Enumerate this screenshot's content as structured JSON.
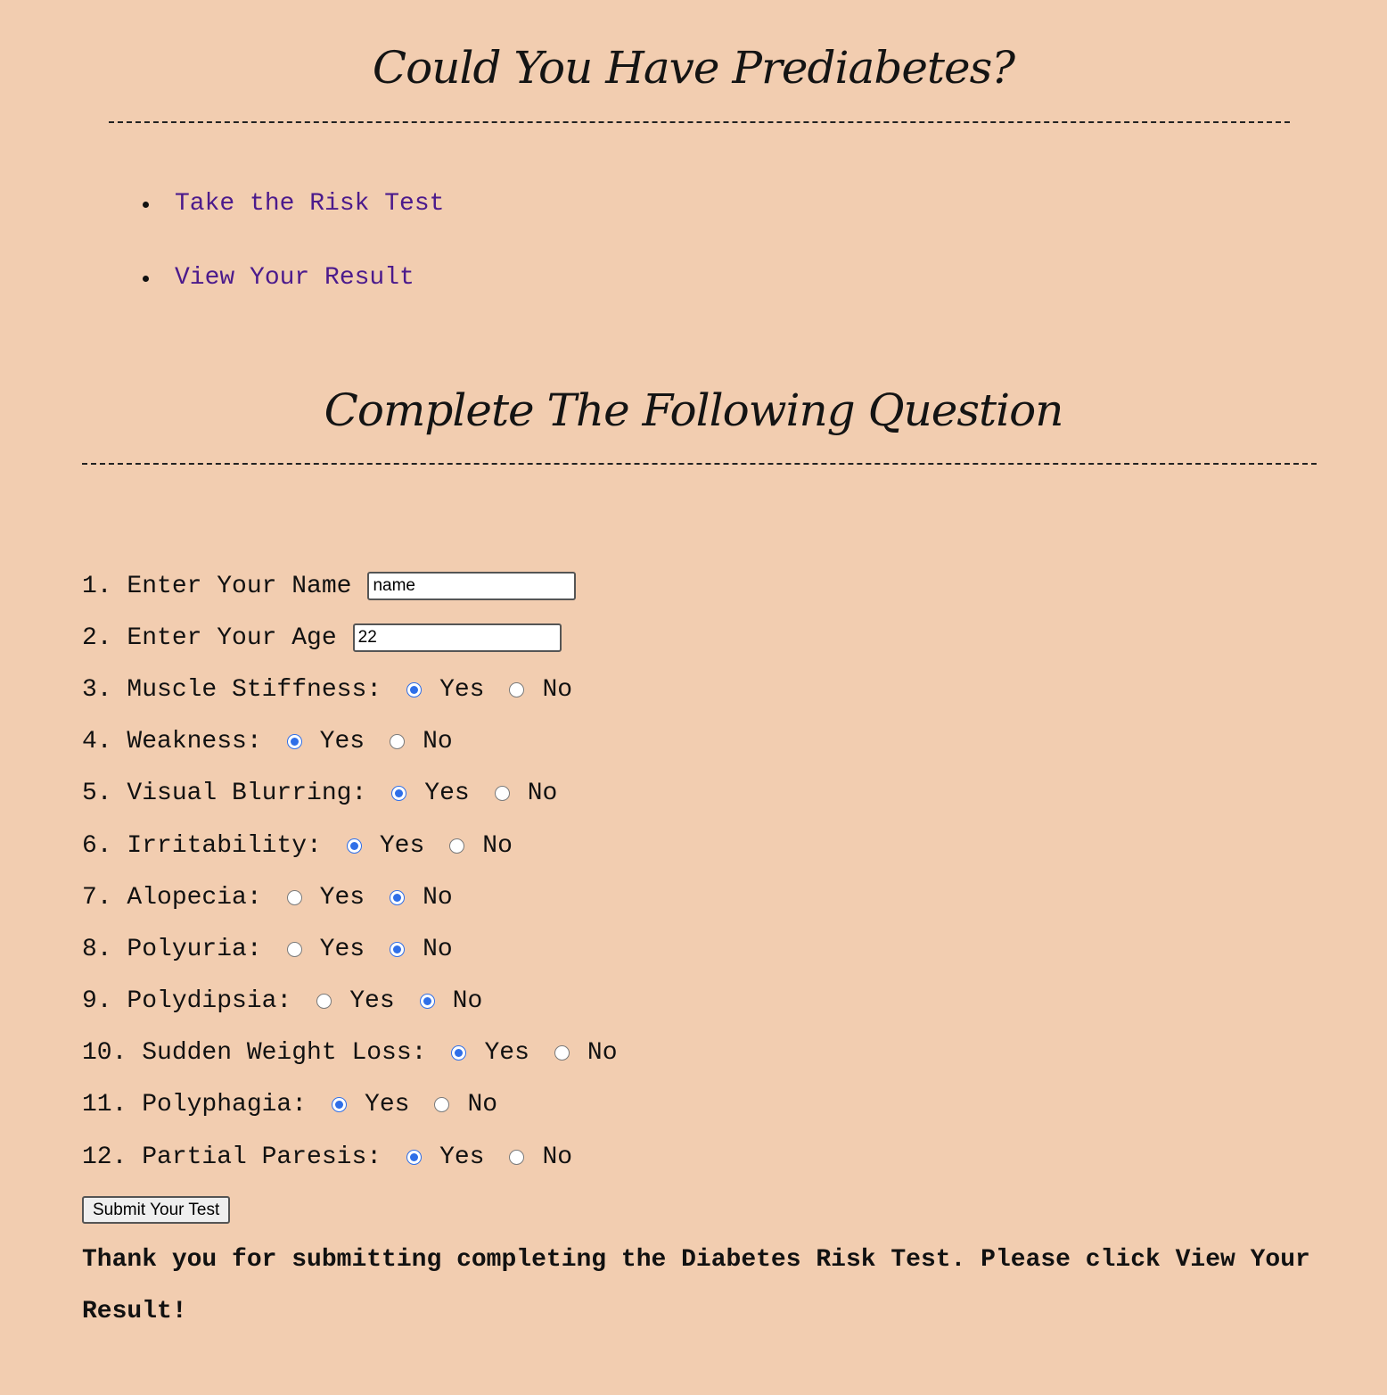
{
  "header": {
    "title": "Could You Have Prediabetes?"
  },
  "nav": {
    "items": [
      {
        "label": "Take the Risk Test"
      },
      {
        "label": "View Your Result"
      }
    ]
  },
  "section": {
    "title": "Complete The Following Question"
  },
  "form": {
    "name_label": "1. Enter Your Name",
    "name_value": "name",
    "age_label": "2. Enter Your Age",
    "age_value": "22",
    "yes_label": "Yes",
    "no_label": "No",
    "questions": [
      {
        "label": "3. Muscle Stiffness:",
        "answer": "Yes"
      },
      {
        "label": "4. Weakness:",
        "answer": "Yes"
      },
      {
        "label": "5. Visual Blurring:",
        "answer": "Yes"
      },
      {
        "label": "6. Irritability:",
        "answer": "Yes"
      },
      {
        "label": "7. Alopecia:",
        "answer": "No"
      },
      {
        "label": "8. Polyuria:",
        "answer": "No"
      },
      {
        "label": "9. Polydipsia:",
        "answer": "No"
      },
      {
        "label": "10. Sudden Weight Loss:",
        "answer": "Yes"
      },
      {
        "label": "11. Polyphagia:",
        "answer": "Yes"
      },
      {
        "label": "12. Partial Paresis:",
        "answer": "Yes"
      }
    ],
    "submit_label": "Submit Your Test"
  },
  "message": {
    "text": "Thank you for submitting completing the Diabetes Risk Test. Please click View Your Result!"
  },
  "colors": {
    "background": "#f2cdb0",
    "link": "#4b1a8c",
    "radio_checked": "#2f6fe8"
  }
}
